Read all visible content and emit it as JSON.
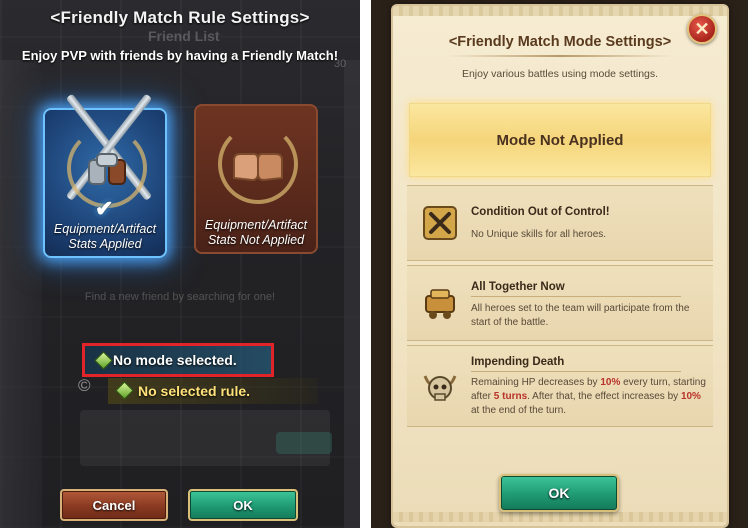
{
  "left": {
    "title": "<Friendly Match Rule Settings>",
    "background_title": "Friend List",
    "background_number": "30",
    "subtitle": "Enjoy PVP with friends by having a Friendly Match!",
    "cards": [
      {
        "label_line1": "Equipment/Artifact",
        "label_line2": "Stats Applied",
        "selected": true,
        "icon": "crossed-swords-gauntlets-icon"
      },
      {
        "label_line1": "Equipment/Artifact",
        "label_line2": "Stats Not Applied",
        "selected": false,
        "icon": "fist-bump-icon"
      }
    ],
    "background_hint": "Find a new friend by searching for one!",
    "mode_status": "No mode selected.",
    "rule_status": "No selected rule.",
    "background_symbol": "©",
    "cancel_label": "Cancel",
    "ok_label": "OK"
  },
  "right": {
    "title": "<Friendly Match Mode Settings>",
    "subtitle": "Enjoy various battles using mode settings.",
    "banner": "Mode Not Applied",
    "close_icon": "close-icon",
    "options": [
      {
        "name": "Condition Out of Control!",
        "desc": "No Unique skills for all heroes.",
        "icon": "crossed-swords-icon"
      },
      {
        "name": "All Together Now",
        "desc": "All heroes set to the team will participate from the start of the battle.",
        "icon": "treasure-cart-icon"
      },
      {
        "name": "Impending Death",
        "desc_parts": [
          "Remaining HP decreases by ",
          "10%",
          " every turn, starting after ",
          "5 turns",
          ". After that, the effect increases by ",
          "10%",
          " at the end of the turn."
        ],
        "icon": "horned-skull-icon"
      }
    ],
    "ok_label": "OK"
  },
  "colors": {
    "selected_glow": "#6ec3ff",
    "highlight_box": "#e0242a",
    "ok_green": "#1f9a72",
    "cancel_red": "#8a3a22",
    "emphasis_red": "#b8322a"
  }
}
